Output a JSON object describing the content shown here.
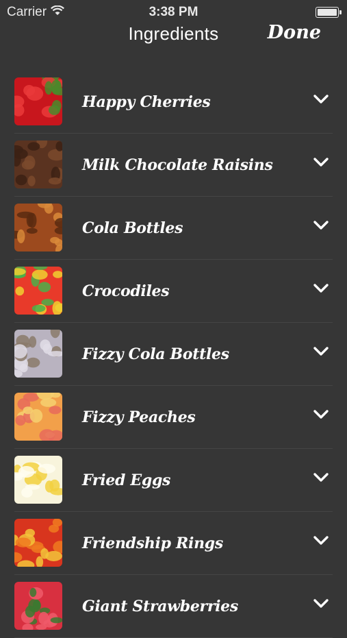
{
  "status_bar": {
    "carrier": "Carrier",
    "time": "3:38 PM"
  },
  "nav": {
    "title": "Ingredients",
    "done_label": "Done"
  },
  "ingredients": [
    {
      "name": "Happy Cherries",
      "colors": [
        "#c8161d",
        "#ea3a3a",
        "#4a8a2a"
      ]
    },
    {
      "name": "Milk Chocolate Raisins",
      "colors": [
        "#5a3320",
        "#7b4a2d",
        "#3c2114"
      ]
    },
    {
      "name": "Cola Bottles",
      "colors": [
        "#9c4a1e",
        "#d98a3a",
        "#5a2a10"
      ]
    },
    {
      "name": "Crocodiles",
      "colors": [
        "#e83a2a",
        "#f0d030",
        "#4ab04a"
      ]
    },
    {
      "name": "Fizzy Cola Bottles",
      "colors": [
        "#b9b3c0",
        "#8a7a6a",
        "#e0dde6"
      ]
    },
    {
      "name": "Fizzy Peaches",
      "colors": [
        "#f2a04a",
        "#f6d070",
        "#e86a5a"
      ]
    },
    {
      "name": "Fried Eggs",
      "colors": [
        "#f8f4dc",
        "#f2d040",
        "#fffdf0"
      ]
    },
    {
      "name": "Friendship Rings",
      "colors": [
        "#d8351e",
        "#f07a20",
        "#f3c43a"
      ]
    },
    {
      "name": "Giant Strawberries",
      "colors": [
        "#d83040",
        "#f05a6a",
        "#3a7a30"
      ]
    }
  ]
}
